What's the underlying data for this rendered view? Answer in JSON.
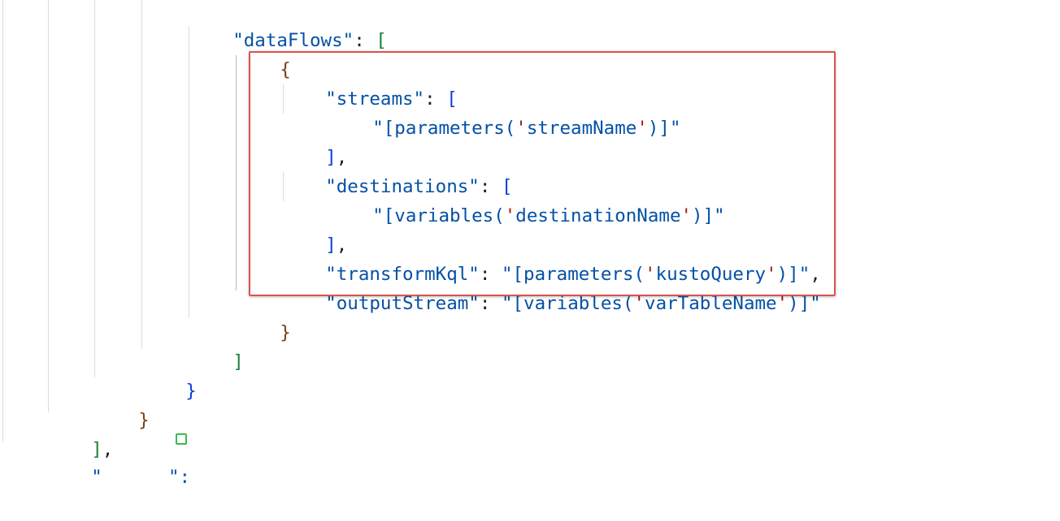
{
  "code": {
    "line1": {
      "key": "\"dataFlows\"",
      "colon": ": ",
      "open": "["
    },
    "line2": {
      "open": "{"
    },
    "line3": {
      "key": "\"streams\"",
      "colon": ": ",
      "open": "["
    },
    "line4": {
      "q1": "\"",
      "fn": "[parameters(",
      "q2": "'",
      "arg": "streamName",
      "q3": "'",
      "close": ")]",
      "q4": "\""
    },
    "line5": {
      "close": "]",
      "comma": ","
    },
    "line6": {
      "key": "\"destinations\"",
      "colon": ": ",
      "open": "["
    },
    "line7": {
      "q1": "\"",
      "fn": "[variables(",
      "q2": "'",
      "arg": "destinationName",
      "q3": "'",
      "close": ")]",
      "q4": "\""
    },
    "line8": {
      "close": "]",
      "comma": ","
    },
    "line9": {
      "key": "\"transformKql\"",
      "colon": ": ",
      "q1": "\"",
      "fn": "[parameters(",
      "q2": "'",
      "arg": "kustoQuery",
      "q3": "'",
      "close": ")]",
      "q4": "\"",
      "comma": ","
    },
    "line10": {
      "key": "\"outputStream\"",
      "colon": ": ",
      "q1": "\"",
      "fn": "[variables(",
      "q2": "'",
      "arg": "varTableName",
      "q3": "'",
      "close": ")]",
      "q4": "\""
    },
    "line11": {
      "close": "}"
    },
    "line12": {
      "close": "]"
    },
    "line13": {
      "close": "}"
    },
    "line14": {
      "close": "}"
    },
    "line15": {
      "close": "]",
      "comma": ","
    },
    "line16": {
      "partial": "\"      \": "
    }
  },
  "colors": {
    "key": "#0451a5",
    "inner_string": "#a31515",
    "bracket_green": "#1a7f37",
    "bracket_brown": "#7b3f12",
    "bracket_blue": "#0b3fd8",
    "highlight_border": "#d9534f"
  },
  "icons": {
    "fold": "fold-marker-icon"
  }
}
